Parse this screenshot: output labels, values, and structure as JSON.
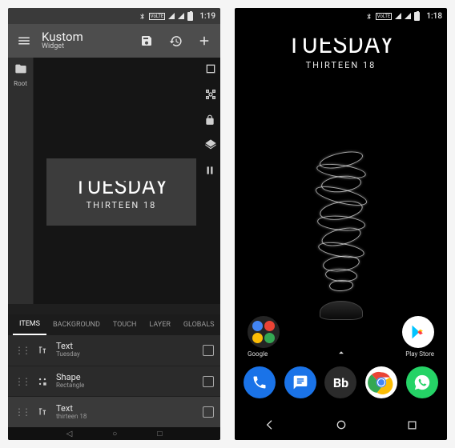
{
  "left": {
    "status": {
      "clock": "1:19"
    },
    "appbar": {
      "title": "Kustom",
      "subtitle": "Widget"
    },
    "rail": {
      "root": "Root"
    },
    "preview": {
      "day": "TUESDAY",
      "sub": "THIRTEEN 18"
    },
    "tabs": {
      "items": "ITEMS",
      "background": "BACKGROUND",
      "touch": "TOUCH",
      "layer": "LAYER",
      "globals": "GLOBALS"
    },
    "list": [
      {
        "type": "Text",
        "value": "Tuesday"
      },
      {
        "type": "Shape",
        "value": "Rectangle"
      },
      {
        "type": "Text",
        "value": "thirteen 18"
      }
    ]
  },
  "right": {
    "status": {
      "clock": "1:18"
    },
    "widget": {
      "day": "TUESDAY",
      "sub": "THIRTEEN 18"
    },
    "labels": {
      "google": "Google",
      "playstore": "Play Store"
    }
  }
}
